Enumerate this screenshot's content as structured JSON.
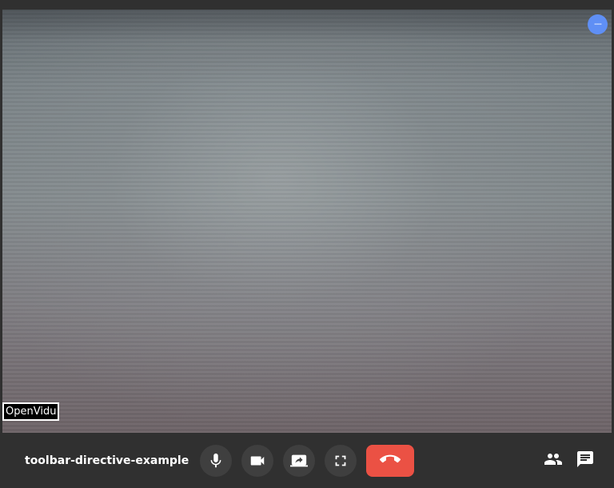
{
  "video": {
    "participant_nickname": "OpenVidu",
    "settings_button_label": "---"
  },
  "toolbar": {
    "session_name": "toolbar-directive-example",
    "buttons": [
      {
        "name": "microphone",
        "icon": "mic-icon"
      },
      {
        "name": "camera",
        "icon": "videocam-icon"
      },
      {
        "name": "screen-share",
        "icon": "screen-share-icon"
      },
      {
        "name": "fullscreen",
        "icon": "fullscreen-icon"
      },
      {
        "name": "leave-session",
        "icon": "call-end-icon"
      }
    ],
    "panel_buttons": [
      {
        "name": "participants",
        "icon": "people-icon"
      },
      {
        "name": "chat",
        "icon": "chat-icon"
      }
    ]
  },
  "colors": {
    "background": "#303030",
    "toolbar_button": "#3f3f3f",
    "leave_button": "#eb5144",
    "settings_button": "#5f8ff5",
    "icon": "#ffffff"
  }
}
